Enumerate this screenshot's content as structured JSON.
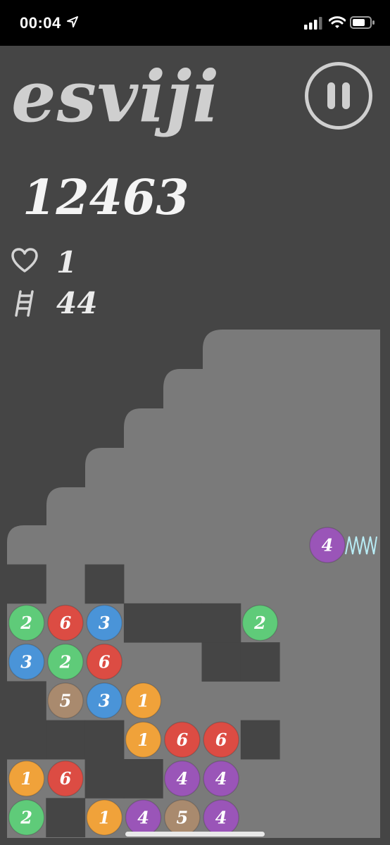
{
  "status_bar": {
    "time": "00:04"
  },
  "game": {
    "title": "esviji",
    "score": "12463",
    "lives": "1",
    "level": "44"
  },
  "colors": {
    "1": "#f0a23a",
    "2": "#5fcb79",
    "3": "#4a94d8",
    "4": "#9a55b8",
    "5": "#a98a6e",
    "6": "#dc4c43",
    "board_background": "#7a7a7a",
    "wall": "#454545"
  },
  "launcher": {
    "ball": 4
  },
  "board": {
    "columns": 10,
    "rows_note": "rows listed top to bottom of the playing field; 0 = empty, -1 = blocked cell",
    "rows": [
      [
        -1,
        0,
        -1,
        0,
        0,
        0,
        0,
        0,
        0,
        0
      ],
      [
        2,
        6,
        3,
        -1,
        -1,
        -1,
        2,
        0,
        0,
        0
      ],
      [
        3,
        2,
        6,
        0,
        0,
        -1,
        -1,
        0,
        0,
        0
      ],
      [
        -1,
        5,
        3,
        1,
        0,
        0,
        0,
        0,
        0,
        0
      ],
      [
        -1,
        -1,
        -1,
        1,
        6,
        6,
        -1,
        0,
        0,
        0
      ],
      [
        1,
        6,
        -1,
        -1,
        4,
        4,
        0,
        0,
        0,
        0
      ],
      [
        2,
        -1,
        1,
        4,
        5,
        4,
        0,
        0,
        0,
        0
      ]
    ]
  }
}
